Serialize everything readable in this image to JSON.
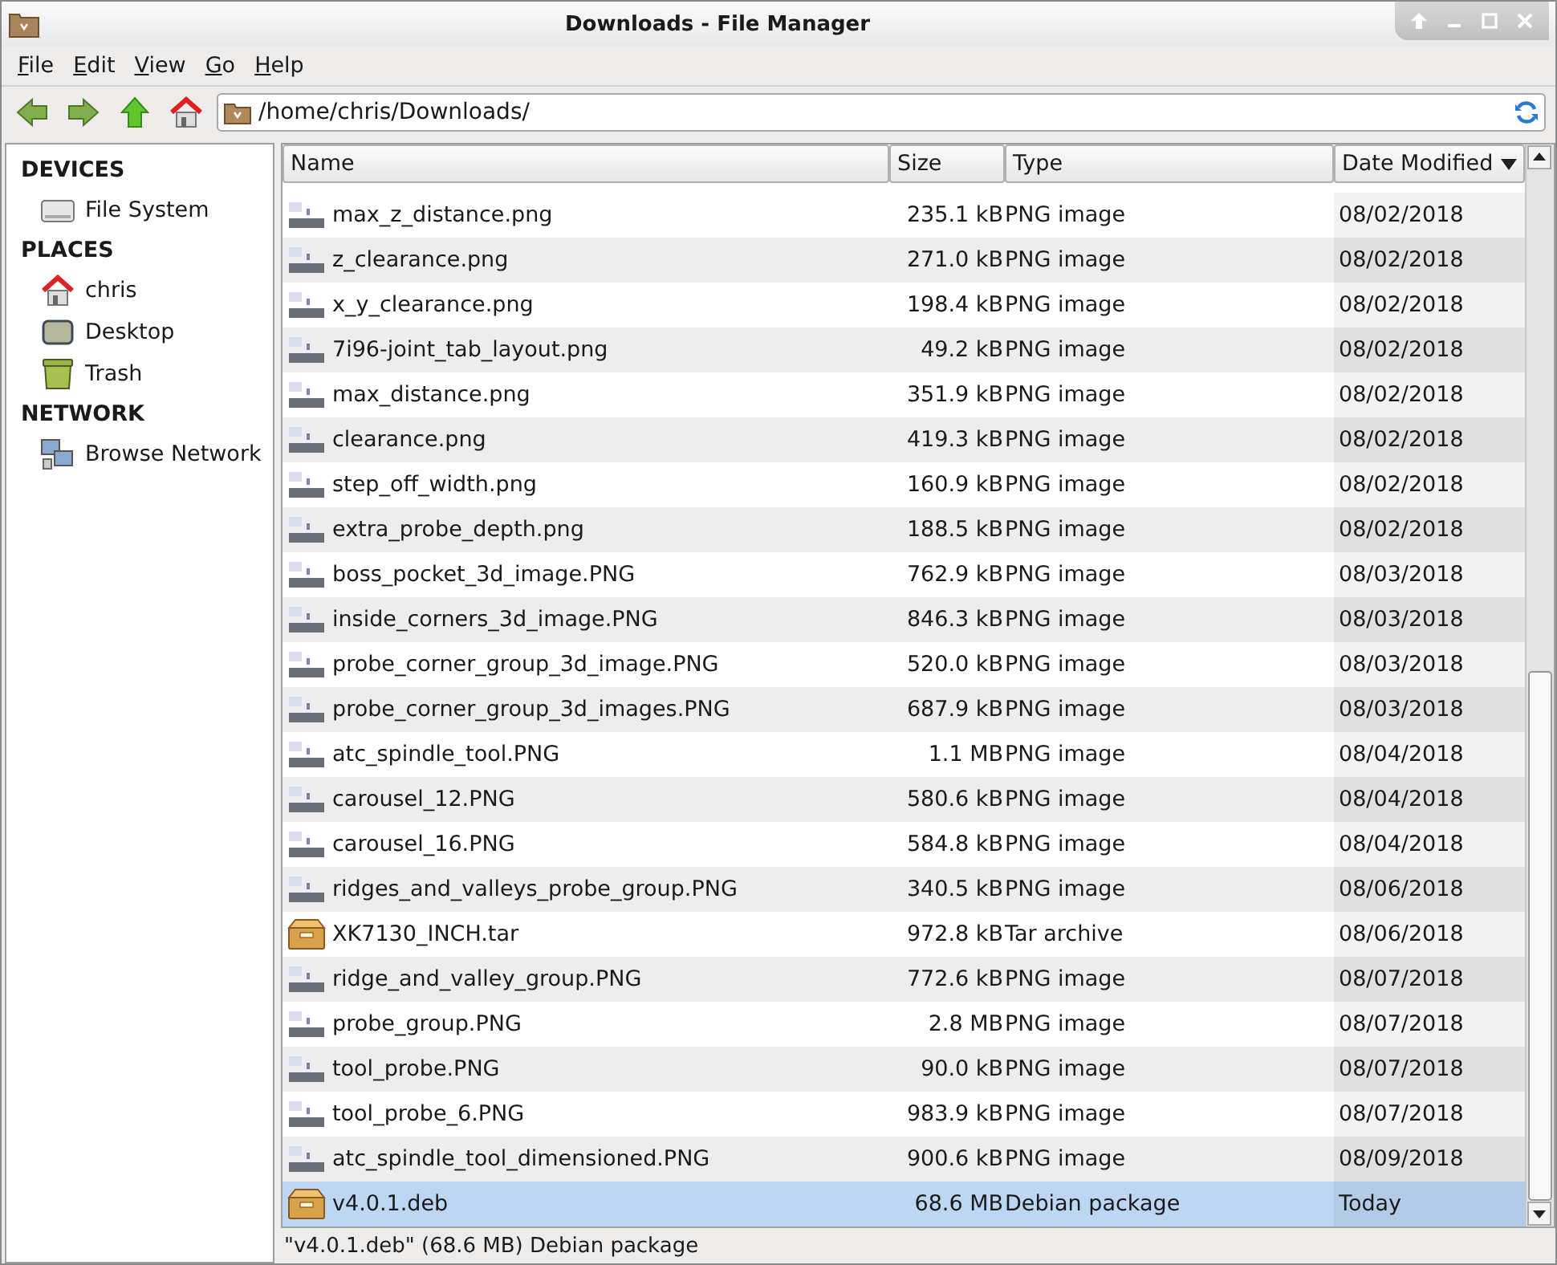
{
  "window": {
    "title": "Downloads - File Manager"
  },
  "menu": [
    "File",
    "Edit",
    "View",
    "Go",
    "Help"
  ],
  "location": {
    "value": "/home/chris/Downloads/"
  },
  "sidebar": [
    {
      "heading": "DEVICES",
      "items": [
        {
          "label": "File System",
          "kind": "drive",
          "selected": false
        }
      ]
    },
    {
      "heading": "PLACES",
      "items": [
        {
          "label": "chris",
          "kind": "home",
          "selected": false
        },
        {
          "label": "Desktop",
          "kind": "desktop",
          "selected": false
        },
        {
          "label": "Trash",
          "kind": "trash",
          "selected": false
        }
      ]
    },
    {
      "heading": "NETWORK",
      "items": [
        {
          "label": "Browse Network",
          "kind": "network",
          "selected": false
        }
      ]
    }
  ],
  "table": {
    "columns": [
      {
        "label": "Name",
        "sorted": false
      },
      {
        "label": "Size",
        "sorted": false
      },
      {
        "label": "Type",
        "sorted": false
      },
      {
        "label": "Date Modified",
        "sorted": true
      }
    ],
    "rows": [
      {
        "name": "max_z_distance.png",
        "size": "235.1 kB",
        "type": "PNG image",
        "date": "08/02/2018",
        "kind": "image",
        "selected": false
      },
      {
        "name": "z_clearance.png",
        "size": "271.0 kB",
        "type": "PNG image",
        "date": "08/02/2018",
        "kind": "image",
        "selected": false
      },
      {
        "name": "x_y_clearance.png",
        "size": "198.4 kB",
        "type": "PNG image",
        "date": "08/02/2018",
        "kind": "image",
        "selected": false
      },
      {
        "name": "7i96-joint_tab_layout.png",
        "size": "49.2 kB",
        "type": "PNG image",
        "date": "08/02/2018",
        "kind": "image",
        "selected": false
      },
      {
        "name": "max_distance.png",
        "size": "351.9 kB",
        "type": "PNG image",
        "date": "08/02/2018",
        "kind": "image",
        "selected": false
      },
      {
        "name": "clearance.png",
        "size": "419.3 kB",
        "type": "PNG image",
        "date": "08/02/2018",
        "kind": "image",
        "selected": false
      },
      {
        "name": "step_off_width.png",
        "size": "160.9 kB",
        "type": "PNG image",
        "date": "08/02/2018",
        "kind": "image",
        "selected": false
      },
      {
        "name": "extra_probe_depth.png",
        "size": "188.5 kB",
        "type": "PNG image",
        "date": "08/02/2018",
        "kind": "image",
        "selected": false
      },
      {
        "name": "boss_pocket_3d_image.PNG",
        "size": "762.9 kB",
        "type": "PNG image",
        "date": "08/03/2018",
        "kind": "image",
        "selected": false
      },
      {
        "name": "inside_corners_3d_image.PNG",
        "size": "846.3 kB",
        "type": "PNG image",
        "date": "08/03/2018",
        "kind": "image",
        "selected": false
      },
      {
        "name": "probe_corner_group_3d_image.PNG",
        "size": "520.0 kB",
        "type": "PNG image",
        "date": "08/03/2018",
        "kind": "image",
        "selected": false
      },
      {
        "name": "probe_corner_group_3d_images.PNG",
        "size": "687.9 kB",
        "type": "PNG image",
        "date": "08/03/2018",
        "kind": "image",
        "selected": false
      },
      {
        "name": "atc_spindle_tool.PNG",
        "size": "1.1 MB",
        "type": "PNG image",
        "date": "08/04/2018",
        "kind": "image",
        "selected": false
      },
      {
        "name": "carousel_12.PNG",
        "size": "580.6 kB",
        "type": "PNG image",
        "date": "08/04/2018",
        "kind": "image",
        "selected": false
      },
      {
        "name": "carousel_16.PNG",
        "size": "584.8 kB",
        "type": "PNG image",
        "date": "08/04/2018",
        "kind": "image",
        "selected": false
      },
      {
        "name": "ridges_and_valleys_probe_group.PNG",
        "size": "340.5 kB",
        "type": "PNG image",
        "date": "08/06/2018",
        "kind": "image",
        "selected": false
      },
      {
        "name": "XK7130_INCH.tar",
        "size": "972.8 kB",
        "type": "Tar archive",
        "date": "08/06/2018",
        "kind": "package",
        "selected": false
      },
      {
        "name": "ridge_and_valley_group.PNG",
        "size": "772.6 kB",
        "type": "PNG image",
        "date": "08/07/2018",
        "kind": "image",
        "selected": false
      },
      {
        "name": "probe_group.PNG",
        "size": "2.8 MB",
        "type": "PNG image",
        "date": "08/07/2018",
        "kind": "image",
        "selected": false
      },
      {
        "name": "tool_probe.PNG",
        "size": "90.0 kB",
        "type": "PNG image",
        "date": "08/07/2018",
        "kind": "image",
        "selected": false
      },
      {
        "name": "tool_probe_6.PNG",
        "size": "983.9 kB",
        "type": "PNG image",
        "date": "08/07/2018",
        "kind": "image",
        "selected": false
      },
      {
        "name": "atc_spindle_tool_dimensioned.PNG",
        "size": "900.6 kB",
        "type": "PNG image",
        "date": "08/09/2018",
        "kind": "image",
        "selected": false
      },
      {
        "name": "v4.0.1.deb",
        "size": "68.6 MB",
        "type": "Debian package",
        "date": "Today",
        "kind": "package",
        "selected": true
      }
    ]
  },
  "status_bar": "\"v4.0.1.deb\" (68.6 MB) Debian package"
}
